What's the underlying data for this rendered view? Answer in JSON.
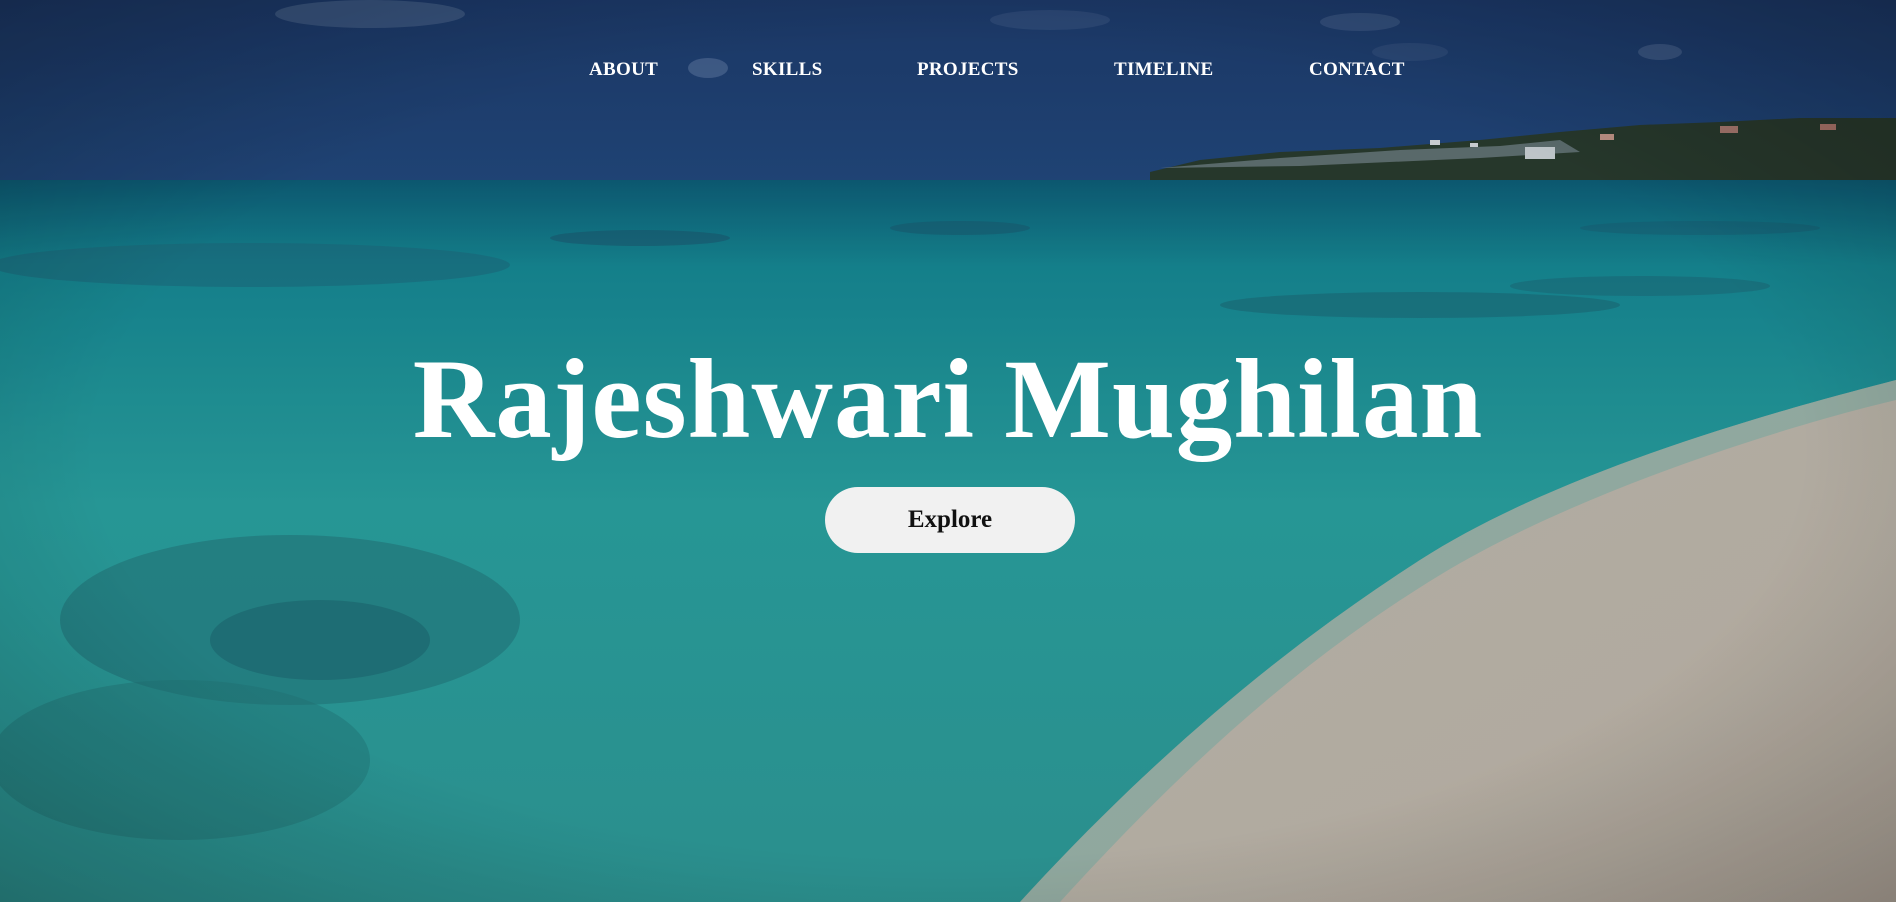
{
  "nav": {
    "items": [
      {
        "label": "ABOUT"
      },
      {
        "label": "SKILLS"
      },
      {
        "label": "PROJECTS"
      },
      {
        "label": "TIMELINE"
      },
      {
        "label": "CONTACT"
      }
    ]
  },
  "hero": {
    "title": "Rajeshwari Mughilan",
    "button_label": "Explore",
    "background_image": "beach-ocean-scene"
  },
  "colors": {
    "nav_text": "#ffffff",
    "title_text": "#ffffff",
    "button_background": "#f1f1f1",
    "button_text": "#111111",
    "sky": "#1f3e70",
    "water": "#2aa3a3",
    "sand": "#cfc7bb"
  }
}
